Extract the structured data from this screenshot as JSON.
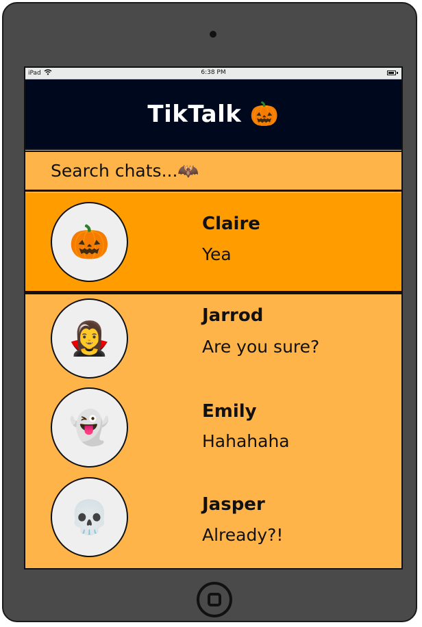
{
  "status_bar": {
    "carrier": "iPad",
    "time": "6:38 PM"
  },
  "header": {
    "title": "TikTalk",
    "title_emoji": "🎃"
  },
  "search": {
    "placeholder": "Search chats...",
    "emoji": "🦇"
  },
  "chats": [
    {
      "name": "Claire",
      "message": "Yea",
      "avatar": "🎃",
      "active": true
    },
    {
      "name": "Jarrod",
      "message": "Are you sure?",
      "avatar": "🧛‍♀️",
      "active": false
    },
    {
      "name": "Emily",
      "message": "Hahahaha",
      "avatar": "👻",
      "active": false
    },
    {
      "name": "Jasper",
      "message": "Already?!",
      "avatar": "💀",
      "active": false
    }
  ],
  "colors": {
    "header_bg": "#00081d",
    "active_row": "#ff9c00",
    "row_bg": "#ffb44a",
    "device": "#4a4a4a"
  }
}
